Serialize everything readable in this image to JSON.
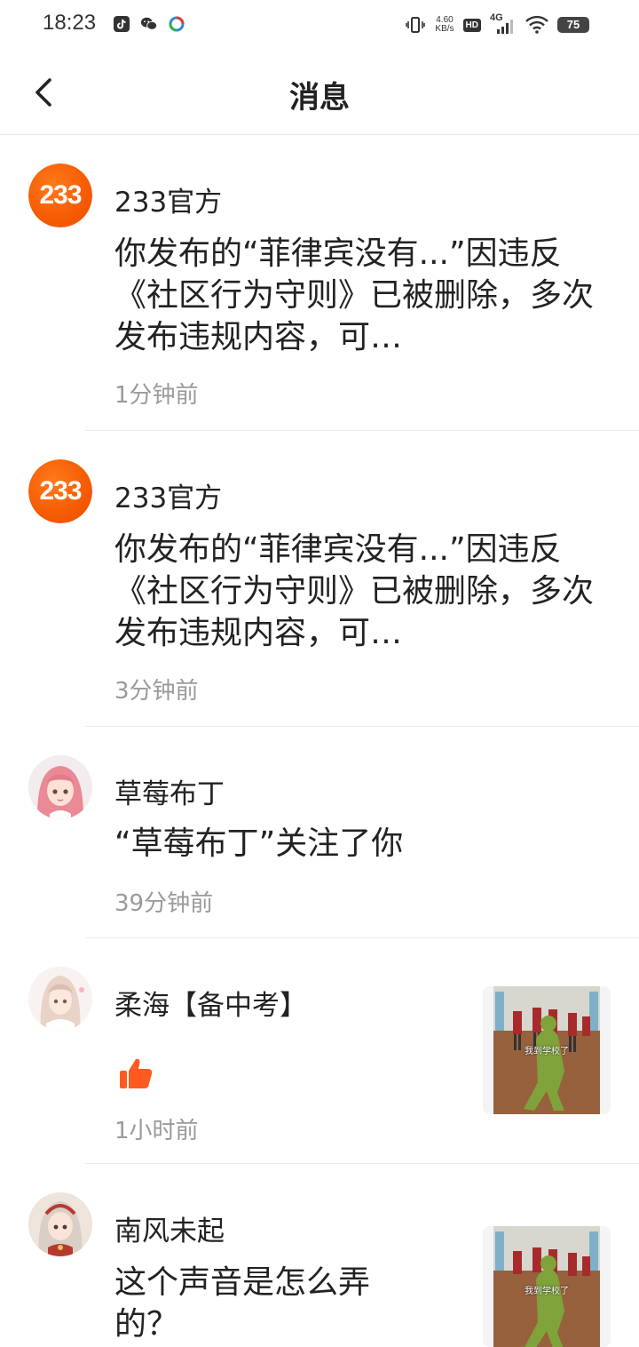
{
  "status_bar": {
    "time": "18:23",
    "net_speed_value": "4.60",
    "net_speed_unit": "KB/s",
    "hd": "HD",
    "network": "4G",
    "battery": "75"
  },
  "header": {
    "title": "消息"
  },
  "messages": [
    {
      "name": "233官方",
      "avatar_text": "233",
      "content": "你发布的“菲律宾没有...”因违反《社区行为守则》已被删除，多次发布违规内容，可…",
      "time": "1分钟前"
    },
    {
      "name": "233官方",
      "avatar_text": "233",
      "content": "你发布的“菲律宾没有...”因违反《社区行为守则》已被删除，多次发布违规内容，可…",
      "time": "3分钟前"
    },
    {
      "name": "草莓布丁",
      "content": "“草莓布丁”关注了你",
      "time": "39分钟前"
    },
    {
      "name": "柔海【备中考】",
      "content_icon": "thumbs-up-icon",
      "time": "1小时前",
      "thumbnail_caption": "我到学校了"
    },
    {
      "name": "南风未起",
      "content": "这个声音是怎么弄的？",
      "thumbnail_caption": "我到学校了"
    }
  ],
  "colors": {
    "brand_orange": "#f35600",
    "like_orange": "#ff5a1f",
    "divider": "#ececec",
    "time_gray": "#9a9a9a"
  }
}
